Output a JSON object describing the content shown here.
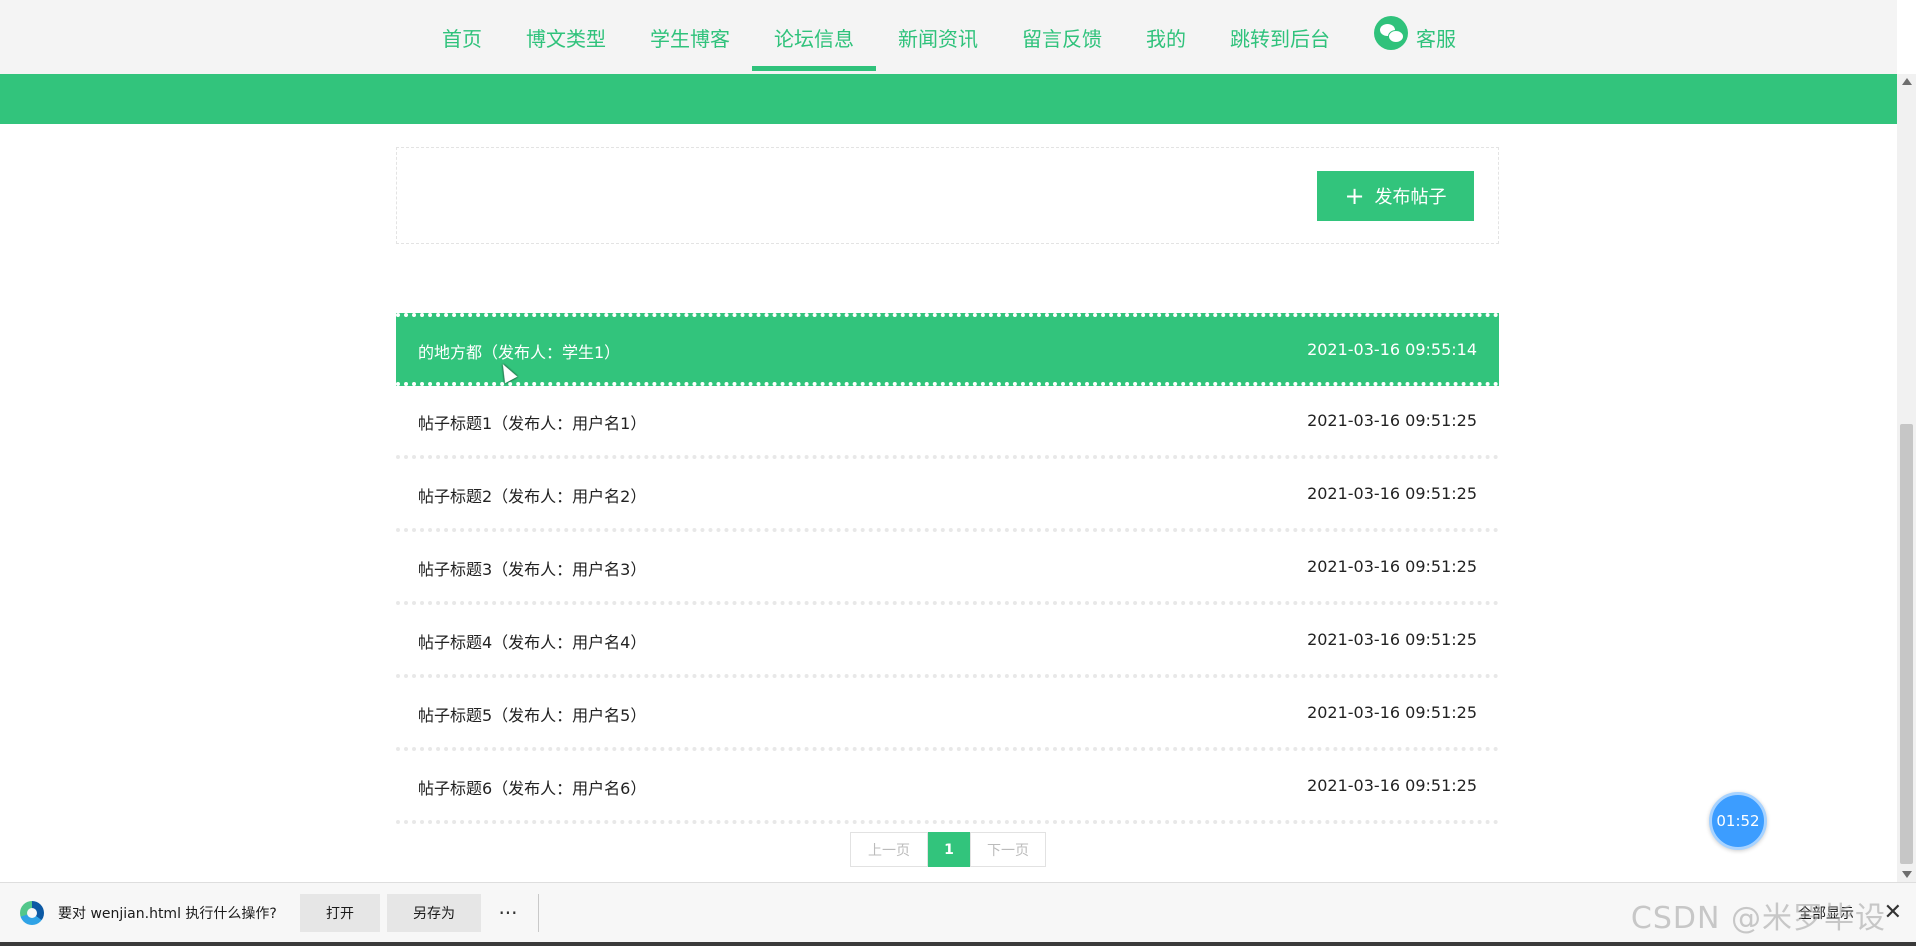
{
  "nav": {
    "items": [
      {
        "label": "首页"
      },
      {
        "label": "博文类型"
      },
      {
        "label": "学生博客"
      },
      {
        "label": "论坛信息"
      },
      {
        "label": "新闻资讯"
      },
      {
        "label": "留言反馈"
      },
      {
        "label": "我的"
      },
      {
        "label": "跳转到后台"
      }
    ],
    "active": "论坛信息",
    "service_label": "客服"
  },
  "actions": {
    "publish_label": "发布帖子"
  },
  "posts": [
    {
      "title": "的地方都（发布人：学生1）",
      "time": "2021-03-16 09:55:14"
    },
    {
      "title": "帖子标题1（发布人：用户名1）",
      "time": "2021-03-16 09:51:25"
    },
    {
      "title": "帖子标题2（发布人：用户名2）",
      "time": "2021-03-16 09:51:25"
    },
    {
      "title": "帖子标题3（发布人：用户名3）",
      "time": "2021-03-16 09:51:25"
    },
    {
      "title": "帖子标题4（发布人：用户名4）",
      "time": "2021-03-16 09:51:25"
    },
    {
      "title": "帖子标题5（发布人：用户名5）",
      "time": "2021-03-16 09:51:25"
    },
    {
      "title": "帖子标题6（发布人：用户名6）",
      "time": "2021-03-16 09:51:25"
    }
  ],
  "pagination": {
    "prev_label": "上一页",
    "current_page": "1",
    "next_label": "下一页"
  },
  "timer": "01:52",
  "download_bar": {
    "prompt": "要对 wenjian.html 执行什么操作?",
    "open_label": "打开",
    "save_as_label": "另存为",
    "more_label": "···",
    "show_all_label": "全部显示",
    "close_label": "✕"
  },
  "watermark": "CSDN @米罗毕设",
  "colors": {
    "accent": "#32c47c",
    "nav_background": "#f4f4f4"
  }
}
